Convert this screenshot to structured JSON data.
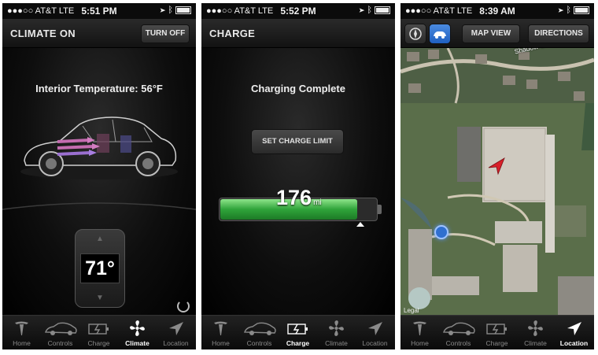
{
  "screens": [
    {
      "status": {
        "carrier": "●●●○○ AT&T  LTE",
        "time": "5:51 PM"
      },
      "header": {
        "title": "CLIMATE ON",
        "button": "TURN OFF"
      },
      "interior_temperature": "Interior Temperature: 56°F",
      "set_temperature": "71°",
      "active_tab": "Climate"
    },
    {
      "status": {
        "carrier": "●●●○○ AT&T  LTE",
        "time": "5:52 PM"
      },
      "header": {
        "title": "CHARGE"
      },
      "charging_status": "Charging Complete",
      "set_charge_limit_button": "SET CHARGE LIMIT",
      "range_value": "176",
      "range_unit": "mi",
      "battery_fill_fraction": 0.88,
      "charge_limit_fraction": 0.9,
      "active_tab": "Charge"
    },
    {
      "status": {
        "carrier": "●●●○○ AT&T  LTE",
        "time": "8:39 AM"
      },
      "header": {
        "map_view_button": "MAP VIEW",
        "directions_button": "DIRECTIONS"
      },
      "street_label": "Shadow Creek Ln",
      "legal_label": "Legal",
      "active_tab": "Location"
    }
  ],
  "tabs": [
    "Home",
    "Controls",
    "Charge",
    "Climate",
    "Location"
  ],
  "colors": {
    "accent_blue": "#2f6fd0",
    "charge_green": "#2fa43a",
    "pin_red": "#d8202a"
  }
}
